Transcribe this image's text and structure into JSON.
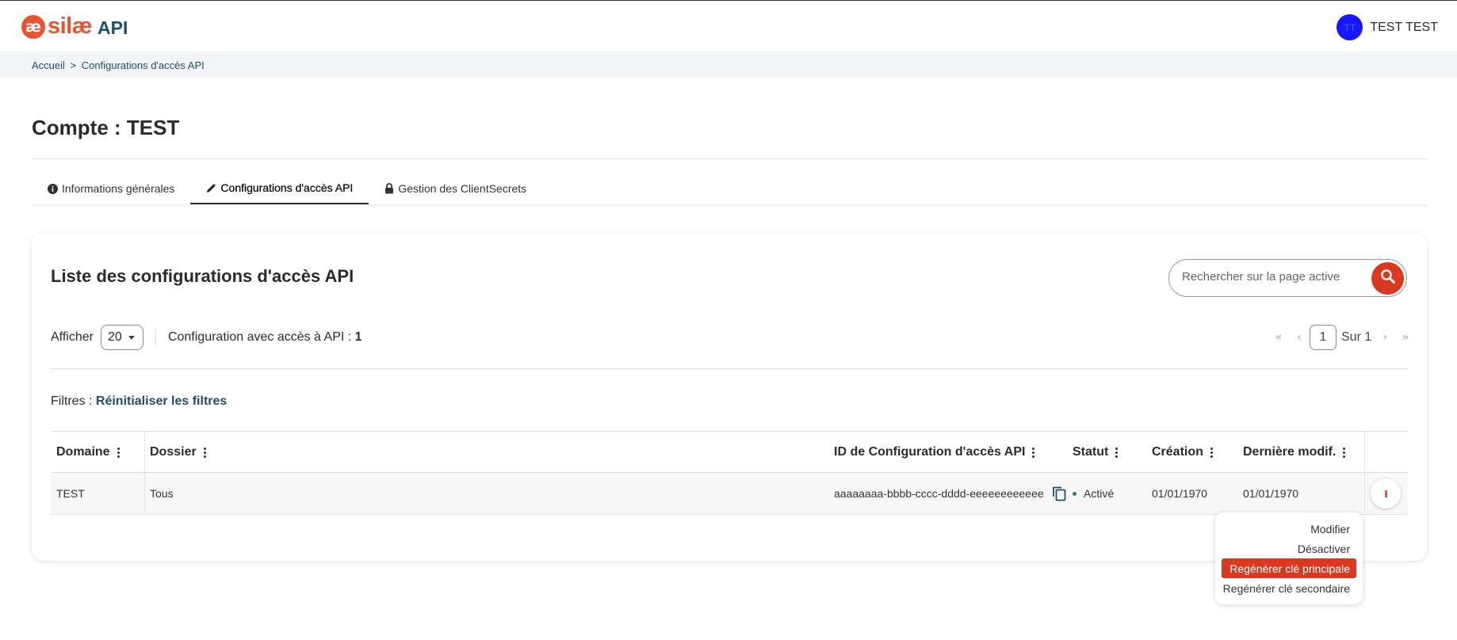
{
  "header": {
    "logo_mark": "æ",
    "logo_text": "silæ",
    "logo_api": "API",
    "user_initials": "TT",
    "user_name": "TEST TEST"
  },
  "breadcrumb": {
    "home": "Accueil",
    "separator": ">",
    "current": "Configurations d'accès API"
  },
  "page": {
    "title": "Compte : TEST"
  },
  "tabs": [
    {
      "label": "Informations générales",
      "icon": "info-circle-icon",
      "active": false
    },
    {
      "label": "Configurations d'accès API",
      "icon": "pencil-icon",
      "active": true
    },
    {
      "label": "Gestion des ClientSecrets",
      "icon": "lock-icon",
      "active": false
    }
  ],
  "card": {
    "title": "Liste des configurations d'accès API",
    "search_placeholder": "Rechercher sur la page active",
    "show_label": "Afficher",
    "page_size": "20",
    "count_label": "Configuration avec accès à API : ",
    "count_value": "1",
    "pager": {
      "current_page": "1",
      "total_label": "Sur 1"
    },
    "filters_label": "Filtres : ",
    "filters_reset": "Réinitialiser les filtres"
  },
  "table": {
    "columns": [
      "Domaine",
      "Dossier",
      "ID de Configuration d'accès API",
      "Statut",
      "Création",
      "Dernière modif."
    ],
    "rows": [
      {
        "domaine": "TEST",
        "dossier": "Tous",
        "config_id": "aaaaaaaa-bbbb-cccc-dddd-eeeeeeeeeeee",
        "statut": "Activé",
        "creation": "01/01/1970",
        "derniere_modif": "01/01/1970"
      }
    ]
  },
  "row_menu": {
    "items": [
      "Modifier",
      "Désactiver",
      "Regénérer clé principale",
      "Regénérer clé secondaire"
    ],
    "highlighted": "Regénérer clé principale"
  },
  "colors": {
    "brand": "#e8542f",
    "accent": "#d8391f",
    "link": "#1f4e6e",
    "status_active": "#1a8a6a",
    "avatar": "#1717ff"
  }
}
